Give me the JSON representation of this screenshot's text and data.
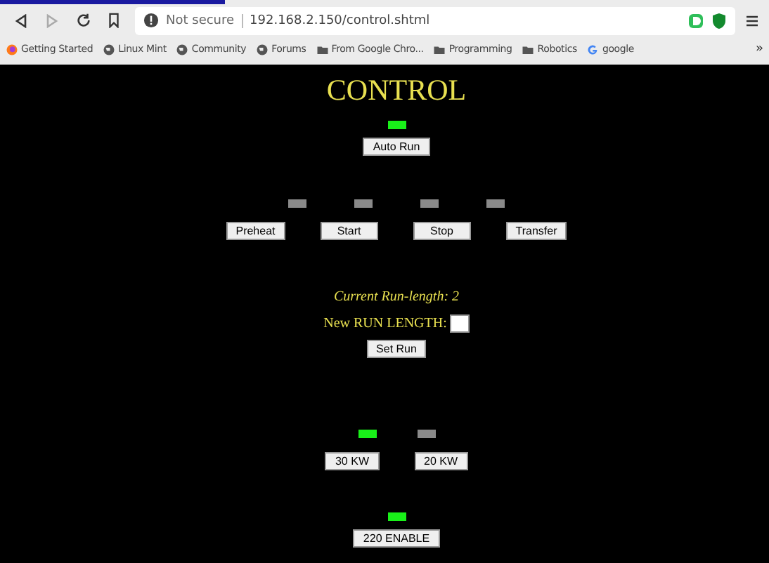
{
  "browser": {
    "security": "Not secure",
    "url": "192.168.2.150/control.shtml",
    "bookmarks": [
      {
        "label": "Getting Started",
        "kind": "firefox"
      },
      {
        "label": "Linux Mint",
        "kind": "globe"
      },
      {
        "label": "Community",
        "kind": "globe"
      },
      {
        "label": "Forums",
        "kind": "globe"
      },
      {
        "label": "From Google Chro...",
        "kind": "folder"
      },
      {
        "label": "Programming",
        "kind": "folder"
      },
      {
        "label": "Robotics",
        "kind": "folder"
      },
      {
        "label": "google",
        "kind": "google"
      }
    ],
    "overflow": "»"
  },
  "page": {
    "title": "CONTROL",
    "auto": {
      "lamp_on": true,
      "button": "Auto Run"
    },
    "stage_lamps": [
      {
        "on": false
      },
      {
        "on": false
      },
      {
        "on": false
      },
      {
        "on": false
      }
    ],
    "stage_buttons": [
      "Preheat",
      "Start",
      "Stop",
      "Transfer"
    ],
    "current_run_length": "Current Run-length: 2",
    "new_run_label": "New RUN LENGTH:",
    "set_run": "Set Run",
    "power": [
      {
        "on": true,
        "button": "30 KW"
      },
      {
        "on": false,
        "button": "20 KW"
      }
    ],
    "enable": {
      "on": true,
      "button": "220 ENABLE"
    }
  }
}
